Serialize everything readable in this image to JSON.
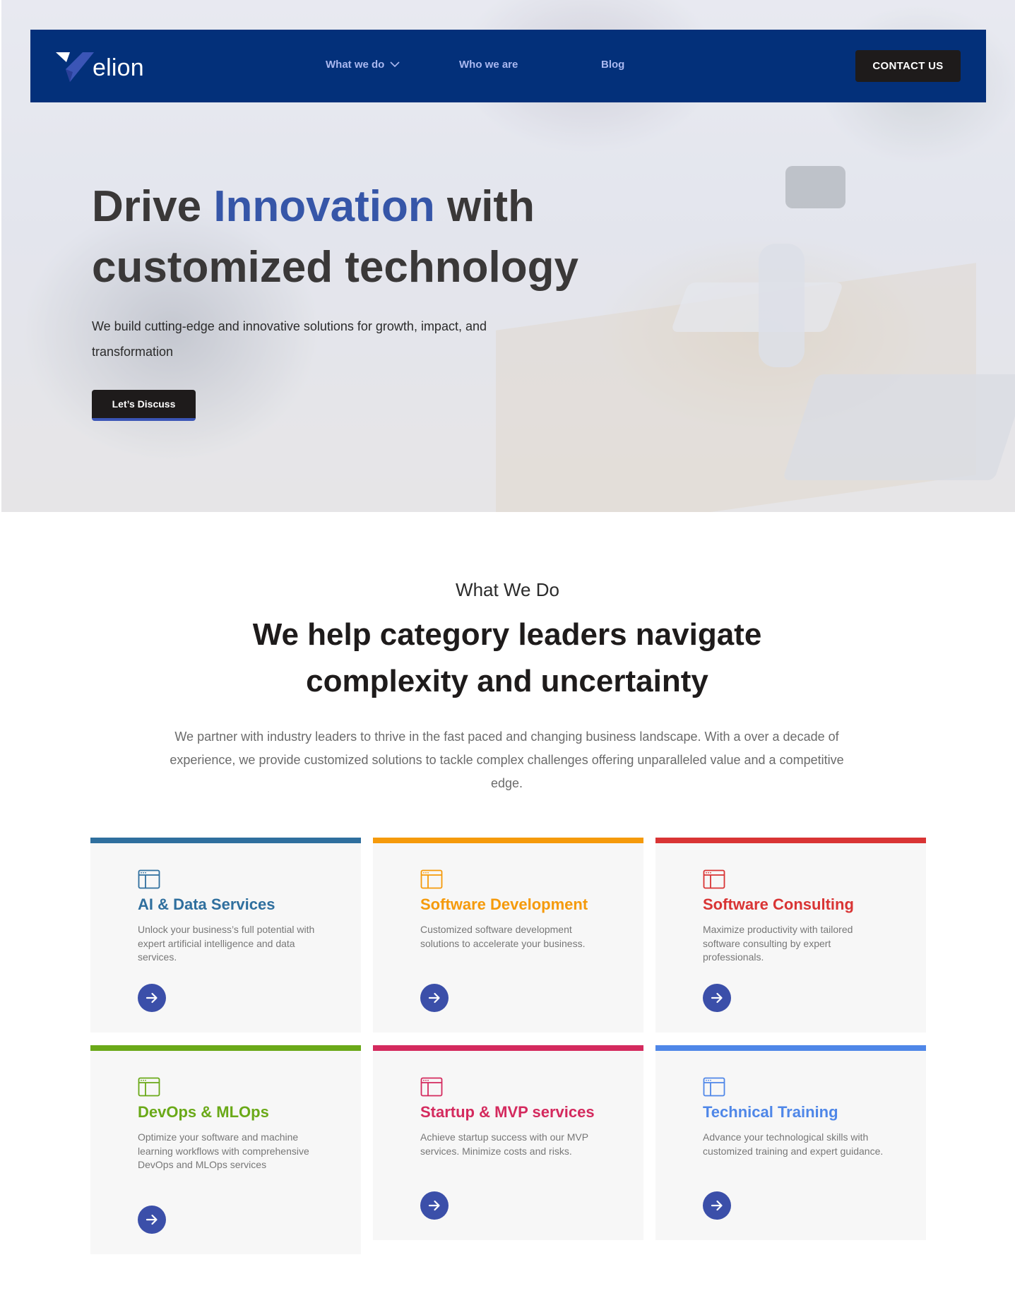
{
  "brand": {
    "name": "elion",
    "nav_color": "#03307a"
  },
  "nav": {
    "items": [
      "What we do",
      "Who we are",
      "Blog"
    ],
    "contact_label": "CONTACT US"
  },
  "hero": {
    "title_part1": "Drive ",
    "title_accent": "Innovation",
    "title_part2": " with customized technology",
    "subtitle": "We build cutting-edge and innovative solutions for growth, impact, and transformation",
    "cta_label": "Let’s Discuss"
  },
  "what_we_do": {
    "eyebrow": "What We Do",
    "heading": "We help category leaders navigate complexity and uncertainty",
    "text": "We partner with industry leaders to thrive in the fast paced and changing business landscape. With a over a decade of experience, we provide customized solutions to tackle complex challenges offering unparalleled value and a competitive edge."
  },
  "services": [
    {
      "title": "AI & Data Services",
      "description": "Unlock your business’s full potential with expert artificial intelligence and data services.",
      "color": "#2f6f9e",
      "icon": "browser-window-icon"
    },
    {
      "title": "Software Development",
      "description": "Customized software development solutions to accelerate your business.",
      "color": "#f59a0b",
      "icon": "browser-window-icon"
    },
    {
      "title": "Software Consulting",
      "description": "Maximize productivity with tailored software consulting by expert professionals.",
      "color": "#d93434",
      "icon": "browser-window-icon"
    },
    {
      "title": "DevOps & MLOps",
      "description": "Optimize your software and machine learning workflows with comprehensive DevOps and MLOps services",
      "color": "#6aa918",
      "icon": "browser-window-icon"
    },
    {
      "title": "Startup & MVP services",
      "description": "Achieve startup success with our MVP services. Minimize costs and risks.",
      "color": "#d42a5e",
      "icon": "browser-window-icon"
    },
    {
      "title": "Technical Training",
      "description": "Advance your technological skills with customized training and expert guidance.",
      "color": "#4f87e8",
      "icon": "browser-window-icon"
    }
  ],
  "colors": {
    "arrow_button": "#3b4fa9",
    "hero_accent": "#3656a8",
    "dark_button": "#1e1b1b"
  }
}
